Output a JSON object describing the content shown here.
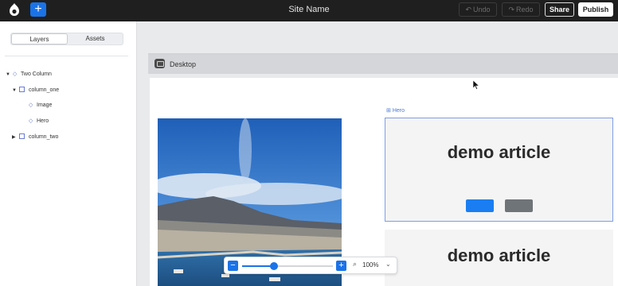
{
  "topbar": {
    "logo_icon": "drupal-drop-icon",
    "add_label": "+",
    "site_name": "Site Name",
    "undo_label": "Undo",
    "redo_label": "Redo",
    "share_label": "Share",
    "publish_label": "Publish"
  },
  "left_panel": {
    "tabs": [
      "Layers",
      "Assets"
    ],
    "active_tab": "Layers",
    "tree": [
      {
        "label": "Two Column",
        "depth": 0,
        "expanded": true,
        "icon": "component-diamond-icon"
      },
      {
        "label": "column_one",
        "depth": 1,
        "expanded": true,
        "icon": "column-square-icon"
      },
      {
        "label": "Image",
        "depth": 2,
        "expanded": null,
        "icon": "component-diamond-icon"
      },
      {
        "label": "Hero",
        "depth": 2,
        "expanded": null,
        "icon": "component-diamond-icon"
      },
      {
        "label": "column_two",
        "depth": 1,
        "expanded": false,
        "icon": "column-square-icon"
      }
    ]
  },
  "canvas": {
    "device_label": "Desktop",
    "hero_tag": "Hero",
    "hero_title": "demo article",
    "article2_title": "demo article",
    "image_alt": "coastal city with volcano"
  },
  "zoom": {
    "value_label": "100%",
    "slider_fraction": 0.35
  },
  "colors": {
    "accent": "#1a73e8",
    "topbar_bg": "#1f1f1f",
    "selection": "#7f9ee6"
  }
}
